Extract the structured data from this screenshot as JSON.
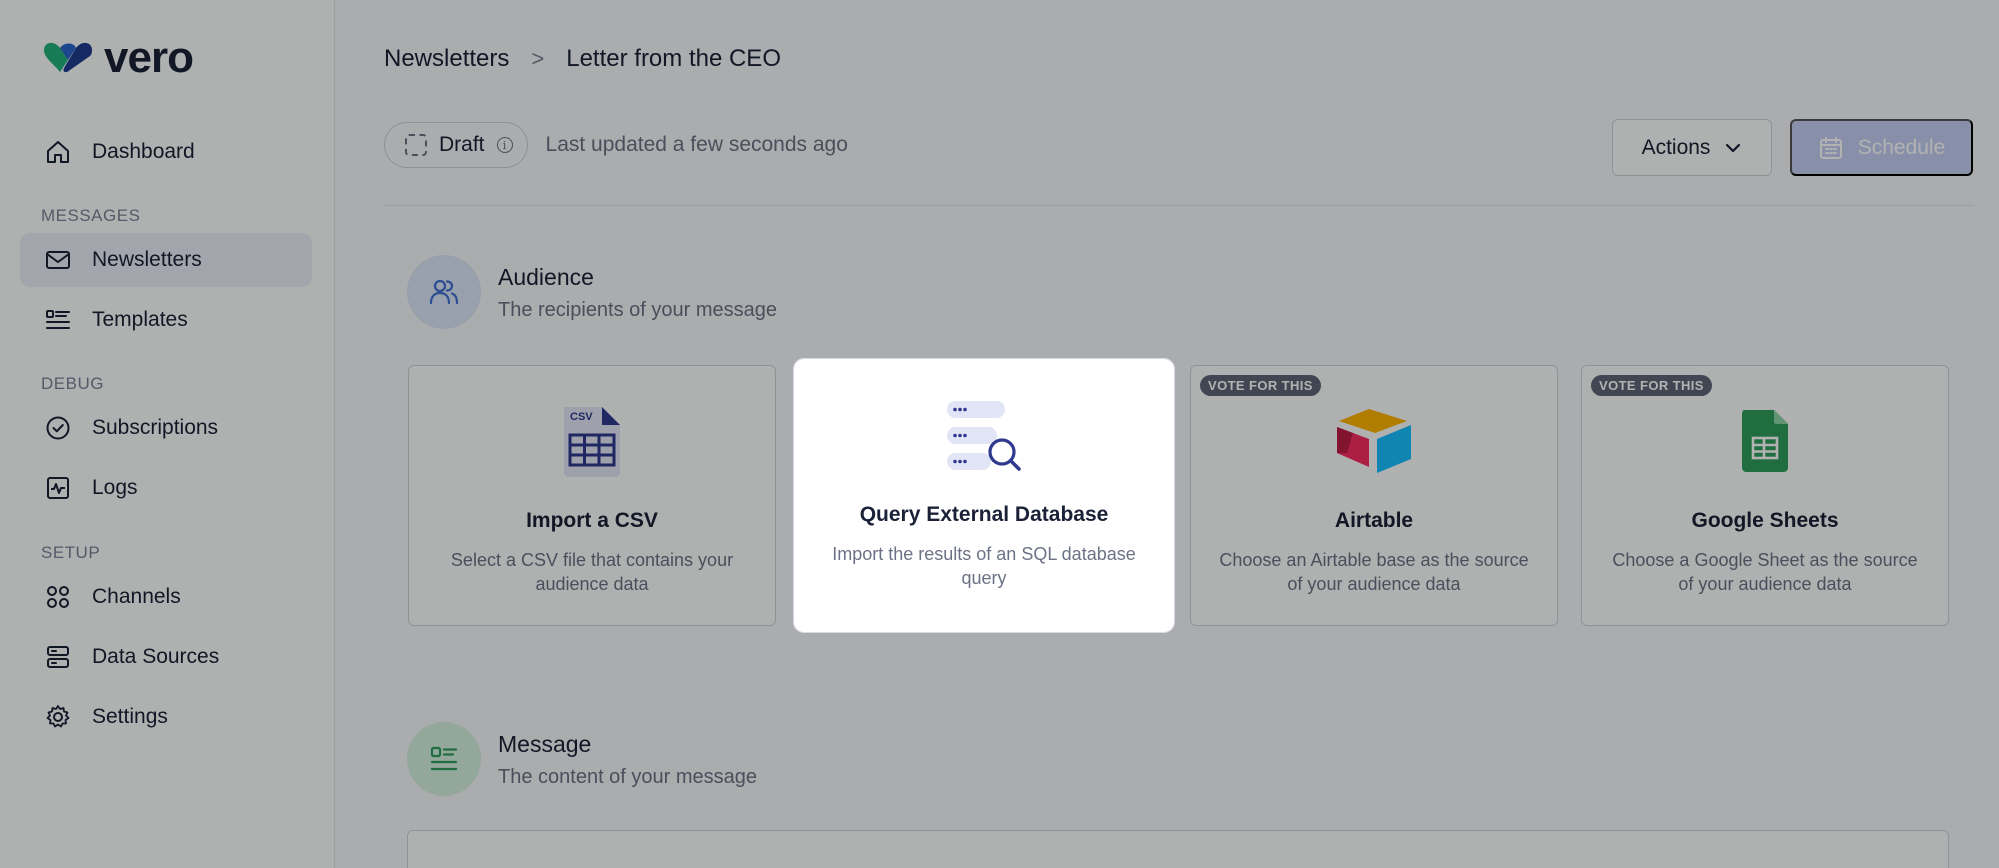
{
  "app": {
    "brand": "vero"
  },
  "sidebar": {
    "dashboard": "Dashboard",
    "sections": {
      "messages": "MESSAGES",
      "debug": "DEBUG",
      "setup": "SETUP"
    },
    "items": [
      {
        "label": "Newsletters",
        "icon": "mail-icon",
        "active": true
      },
      {
        "label": "Templates",
        "icon": "list-icon"
      },
      {
        "label": "Subscriptions",
        "icon": "check-circle-icon"
      },
      {
        "label": "Logs",
        "icon": "activity-icon"
      },
      {
        "label": "Channels",
        "icon": "grid-icon"
      },
      {
        "label": "Data Sources",
        "icon": "server-icon"
      },
      {
        "label": "Settings",
        "icon": "gear-icon"
      }
    ]
  },
  "breadcrumb": {
    "root": "Newsletters",
    "separator": ">",
    "current": "Letter from the CEO"
  },
  "status": {
    "badge": "Draft",
    "info_glyph": "i",
    "updated": "Last updated a few seconds ago"
  },
  "toolbar": {
    "actions": "Actions",
    "schedule": "Schedule"
  },
  "audience": {
    "title": "Audience",
    "subtitle": "The recipients of your message",
    "cards": [
      {
        "title": "Import a CSV",
        "desc": "Select a CSV file that contains your audience data",
        "icon_label": "CSV"
      },
      {
        "title": "Query External Database",
        "desc": "Import the results of an SQL database query",
        "selected": true
      },
      {
        "title": "Airtable",
        "desc": "Choose an Airtable base as the source of your audience data",
        "badge": "VOTE FOR THIS"
      },
      {
        "title": "Google Sheets",
        "desc": "Choose a Google Sheet as the source of your audience data",
        "badge": "VOTE FOR THIS"
      }
    ]
  },
  "message": {
    "title": "Message",
    "subtitle": "The content of your message"
  },
  "colors": {
    "accent": "#3f5bd8",
    "schedule_bg": "#c2cdf3",
    "audience_icon_bg": "#d9e6f7",
    "message_icon_bg": "#d3f0df",
    "sheets_green": "#2e9e5b"
  }
}
